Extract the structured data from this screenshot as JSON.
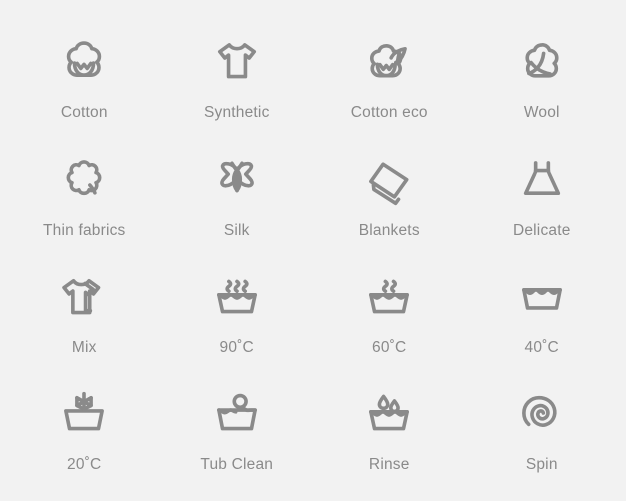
{
  "page": {
    "title": "Laundry Program Icons",
    "background_color": "#f2f2f2",
    "icon_stroke_color": "#8a8a8a",
    "label_color": "#8a8a8a",
    "columns": 4,
    "rows": 4
  },
  "icons": [
    {
      "label": "Cotton",
      "icon_name": "cotton-boll-icon"
    },
    {
      "label": "Synthetic",
      "icon_name": "tshirt-icon"
    },
    {
      "label": "Cotton eco",
      "icon_name": "cotton-boll-leaf-icon"
    },
    {
      "label": "Wool",
      "icon_name": "wool-yarn-ball-icon"
    },
    {
      "label": "Thin fabrics",
      "icon_name": "scalloped-flower-icon"
    },
    {
      "label": "Silk",
      "icon_name": "butterfly-icon"
    },
    {
      "label": "Blankets",
      "icon_name": "folded-blanket-icon"
    },
    {
      "label": "Delicate",
      "icon_name": "dress-icon"
    },
    {
      "label": "Mix",
      "icon_name": "two-tshirts-icon"
    },
    {
      "label": "90˚C",
      "icon_name": "wash-tub-three-steam-icon"
    },
    {
      "label": "60˚C",
      "icon_name": "wash-tub-two-steam-icon"
    },
    {
      "label": "40˚C",
      "icon_name": "wash-tub-icon"
    },
    {
      "label": "20˚C",
      "icon_name": "wash-tub-snowflake-icon"
    },
    {
      "label": "Tub Clean",
      "icon_name": "tub-clean-bubble-icon"
    },
    {
      "label": "Rinse",
      "icon_name": "wash-tub-droplets-icon"
    },
    {
      "label": "Spin",
      "icon_name": "spiral-spin-icon"
    }
  ]
}
